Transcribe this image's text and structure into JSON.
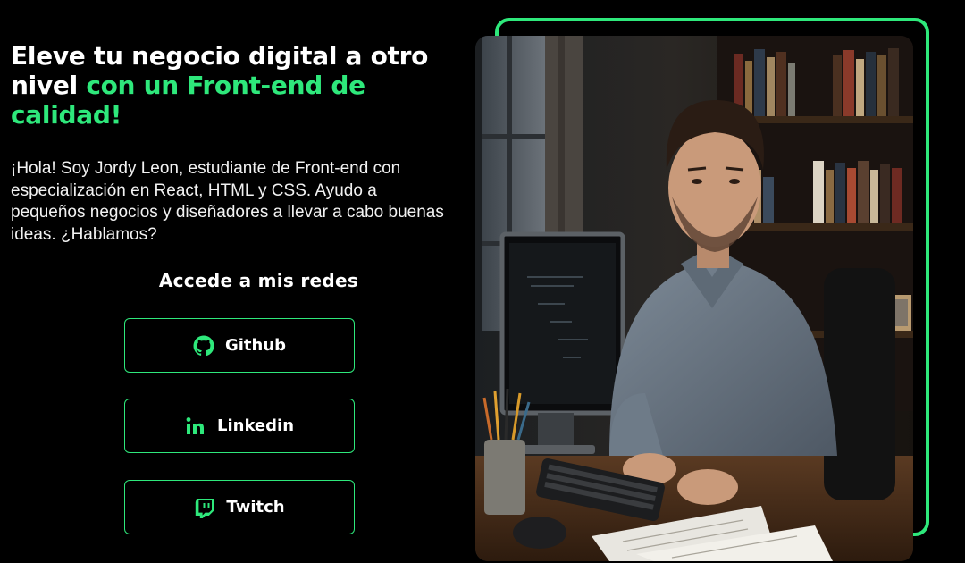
{
  "hero": {
    "headline_plain": "Eleve tu negocio digital a otro nivel ",
    "headline_accent": "con un Front-end de calidad!",
    "intro": "¡Hola! Soy Jordy Leon, estudiante de Front-end con especialización en React, HTML y CSS. Ayudo a pequeños negocios y diseñadores a llevar a cabo buenas ideas. ¿Hablamos?"
  },
  "social": {
    "title": "Accede a mis redes",
    "links": [
      {
        "label": "Github",
        "icon": "github-icon"
      },
      {
        "label": "Linkedin",
        "icon": "linkedin-icon"
      },
      {
        "label": "Twitch",
        "icon": "twitch-icon"
      }
    ]
  },
  "colors": {
    "accent": "#2ee87b",
    "background": "#000000",
    "text": "#ffffff"
  }
}
